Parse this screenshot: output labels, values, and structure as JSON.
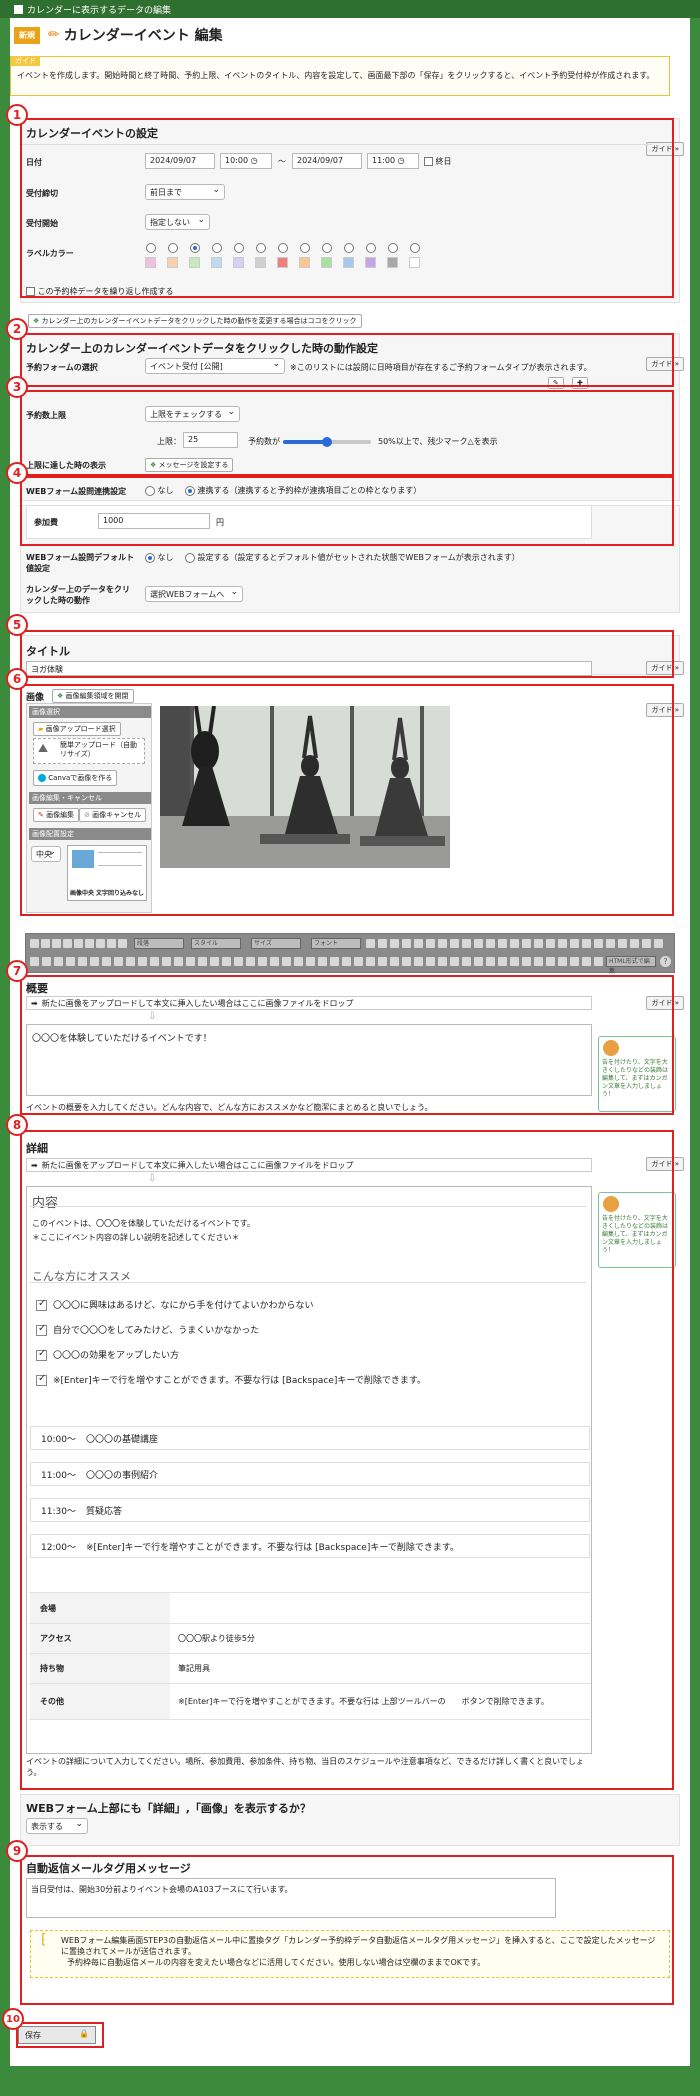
{
  "window": {
    "title": "カレンダーに表示するデータの編集"
  },
  "header": {
    "badge": "新規",
    "title": "カレンダーイベント 編集"
  },
  "guide": {
    "tag": "ガイド",
    "text": "イベントを作成します。開始時間と終了時間、予約上限、イベントのタイトル、内容を設定して、画面最下部の「保存」をクリックすると、イベント予約受付枠が作成されます。"
  },
  "guide_button": "ガイド »",
  "markers": [
    "1",
    "2",
    "3",
    "4",
    "5",
    "6",
    "7",
    "8",
    "9",
    "10"
  ],
  "s1": {
    "title": "カレンダーイベントの設定",
    "date_label": "日付",
    "start_date": "2024/09/07",
    "start_time": "10:00",
    "tilde": "〜",
    "end_date": "2024/09/07",
    "end_time": "11:00",
    "allday": "終日",
    "deadline_label": "受付締切",
    "deadline_value": "前日まで",
    "start_label": "受付開始",
    "start_value": "指定しない",
    "color_label": "ラベルカラー",
    "colors": [
      "#f0c0e0",
      "#f8d0b0",
      "#c8e8c0",
      "#c0d8f0",
      "#d8d0f0",
      "#d0d0d0",
      "#f08080",
      "#f8c890",
      "#a8e0a0",
      "#a8c8f0",
      "#c0a8e8",
      "#a8a8a8",
      "#ffffff"
    ],
    "repeat": "この予約枠データを繰り返し作成する",
    "calendar_click_link": "カレンダー上のカレンダーイベントデータをクリックした時の動作を変更する場合はココをクリック"
  },
  "s2": {
    "title": "カレンダー上のカレンダーイベントデータをクリックした時の動作設定",
    "form_label": "予約フォームの選択",
    "form_value": "イベント受付 [公開]",
    "form_note": "※このリストには設問に日時項目が存在するご予約フォームタイプが表示されます。"
  },
  "s3": {
    "limit_label": "予約数上限",
    "limit_value": "上限をチェックする",
    "upper_label": "上限：",
    "upper_value": "25",
    "count_label": "予約数が",
    "slider_level": 0.5,
    "slider_note": "50%以上で、残少マーク△を表示",
    "reached_label": "上限に達した時の表示",
    "reached_btn": "メッセージを設定する"
  },
  "s4": {
    "link_label": "WEBフォーム設問連携設定",
    "opt_none": "なし",
    "opt_link": "連携する（連携すると予約枠が連携項目ごとの枠となります）",
    "fee_label": "参加費",
    "fee_value": "1000",
    "yen": "円",
    "default_label": "WEBフォーム設問デフォルト値設定",
    "default_none": "なし",
    "default_set": "設定する（設定するとデフォルト値がセットされた状態でWEBフォームが表示されます）",
    "click_label": "カレンダー上のデータをクリックした時の動作",
    "click_value": "選択WEBフォームへ"
  },
  "s5": {
    "title": "タイトル",
    "value": "ヨガ体験"
  },
  "s6": {
    "title": "画像",
    "header_btn": "画像編集領域を開閉",
    "select_section": "画像選択",
    "upload_btn": "画像アップロード選択",
    "simple_upload": "簡単アップロード（自動リサイズ）",
    "canva": "Canvaで画像を作る",
    "edit_section": "画像編集・キャンセル",
    "edit_btn": "画像編集",
    "cancel_btn": "画像キャンセル",
    "layout_section": "画像配置設定",
    "align_value": "中央",
    "layout_caption": "画像中央 文字回り込みなし"
  },
  "toolbar": {
    "selects": [
      "段落",
      "スタイル",
      "サイズ",
      "フォント"
    ],
    "html_btn": "HTML形式で編集"
  },
  "s7": {
    "title": "概要",
    "drop": "新たに画像をアップロードして本文に挿入したい場合はここに画像ファイルをドロップ",
    "body": "〇〇〇を体験していただけるイベントです！",
    "help": "イベントの概要を入力してください。どんな内容で、どんな方におススメかなど簡潔にまとめると良いでしょう。",
    "tip": "告を付けたり、文字を大きくしたりなどの装飾は編集して、まずはカンガン文章を入力しましょう！"
  },
  "s8": {
    "title": "詳細",
    "drop": "新たに画像をアップロードして本文に挿入したい場合はここに画像ファイルをドロップ",
    "heading": "内容",
    "intro1": "このイベントは、〇〇〇を体験していただけるイベントです。",
    "intro2": "＊ここにイベント内容の詳しい説明を記述してください＊",
    "recommend": "こんな方にオススメ",
    "checks": [
      "〇〇〇に興味はあるけど、なにから手を付けてよいかわからない",
      "自分で〇〇〇をしてみたけど、うまくいかなかった",
      "〇〇〇の効果をアップしたい方",
      "※[Enter]キーで行を増やすことができます。不要な行は [Backspace]キーで削除できます。"
    ],
    "schedule": [
      {
        "time": "10:00〜",
        "text": "〇〇〇の基礎講座"
      },
      {
        "time": "11:00〜",
        "text": "〇〇〇の事例紹介"
      },
      {
        "time": "11:30〜",
        "text": "質疑応答"
      },
      {
        "time": "12:00〜",
        "text": "※[Enter]キーで行を増やすことができます。不要な行は [Backspace]キーで削除できます。"
      }
    ],
    "table": [
      {
        "th": "会場",
        "td": ""
      },
      {
        "th": "アクセス",
        "td": "〇〇〇駅より徒歩5分"
      },
      {
        "th": "持ち物",
        "td": "筆記用具"
      },
      {
        "th": "その他",
        "td": "※[Enter]キーで行を増やすことができます。不要な行は 上部ツールバーの　　ボタンで削除できます。"
      }
    ],
    "help": "イベントの詳細について入力してください。場所、参加費用、参加条件、持ち物、当日のスケジュールや注意事項など、できるだけ詳しく書くと良いでしょう。",
    "tip": "告を付けたり、文字を大きくしたりなどの装飾は編集して、まずはカンガン文章を入力しましょう！"
  },
  "display": {
    "question": "WEBフォーム上部にも「詳細」,「画像」を表示するか？",
    "value": "表示する"
  },
  "s9": {
    "title": "自動返信メールタグ用メッセージ",
    "value": "当日受付は、開始30分前よりイベント会場のA103ブースにて行います。",
    "note1": "WEBフォーム編集画面STEP3の自動返信メール中に置換タグ「カレンダー予約枠データ自動返信メールタグ用メッセージ」を挿入すると、ここで設定したメッセージに置換されてメールが送信されます。",
    "note2": "予約枠毎に自動返信メールの内容を変えたい場合などに活用してください。使用しない場合は空欄のままでOKです。"
  },
  "s10": {
    "save": "保存"
  }
}
